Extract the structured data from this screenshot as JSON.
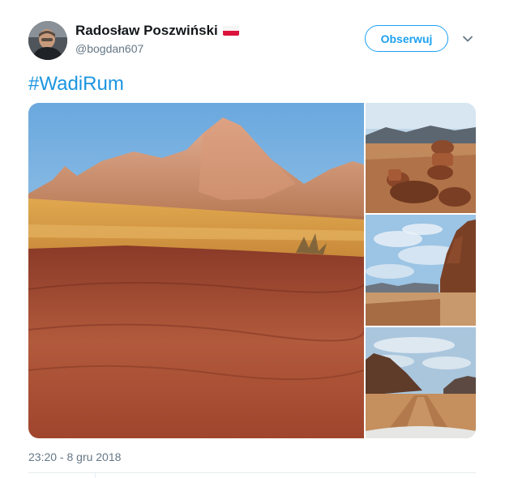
{
  "author": {
    "display_name": "Radosław Poszwiński",
    "handle": "@bogdan607",
    "flag_icon": "poland-flag-icon"
  },
  "follow_button": {
    "label": "Obserwuj"
  },
  "menu_icon": "chevron-down-icon",
  "tweet": {
    "text": "#WadiRum",
    "timestamp": "23:20 - 8 gru 2018"
  },
  "media": [
    {
      "name": "photo-desert-mountain",
      "description_icon": "image"
    },
    {
      "name": "photo-rock-stack",
      "description_icon": "image"
    },
    {
      "name": "photo-cliff-sky",
      "description_icon": "image"
    },
    {
      "name": "photo-desert-road",
      "description_icon": "image"
    }
  ],
  "colors": {
    "accent": "#1da1f2",
    "hashtag": "#1b95e0",
    "muted": "#657786",
    "divider": "#e6ecf0"
  }
}
